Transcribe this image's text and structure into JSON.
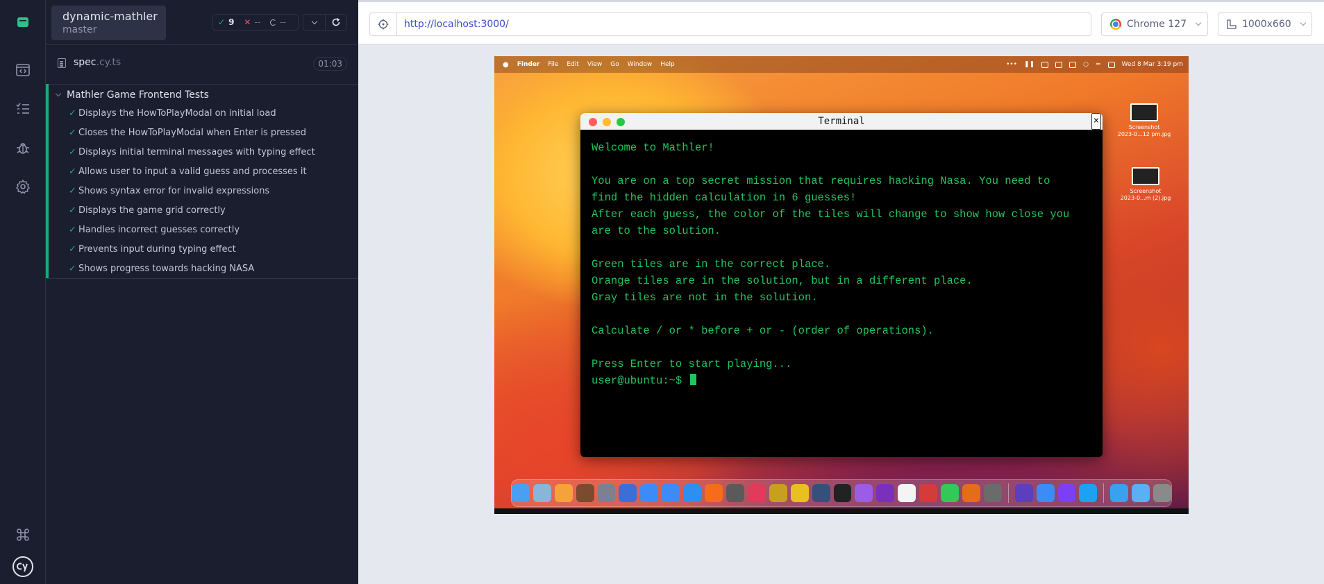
{
  "project": {
    "name": "dynamic-mathler",
    "branch": "master"
  },
  "stats": {
    "passed": "9",
    "failed": "--",
    "pending": "--"
  },
  "spec": {
    "name": "spec",
    "ext": ".cy.ts",
    "duration": "01:03"
  },
  "suite": {
    "title": "Mathler Game Frontend Tests",
    "tests": [
      "Displays the HowToPlayModal on initial load",
      "Closes the HowToPlayModal when Enter is pressed",
      "Displays initial terminal messages with typing effect",
      "Allows user to input a valid guess and processes it",
      "Shows syntax error for invalid expressions",
      "Displays the game grid correctly",
      "Handles incorrect guesses correctly",
      "Prevents input during typing effect",
      "Shows progress towards hacking NASA"
    ]
  },
  "browser": {
    "url": "http://localhost:3000/",
    "name": "Chrome 127",
    "viewport": "1000x660"
  },
  "mac": {
    "menu": [
      "Finder",
      "File",
      "Edit",
      "View",
      "Go",
      "Window",
      "Help"
    ],
    "clock": "Wed 8 Mar  3:19 pm",
    "desktop_files": [
      {
        "line1": "Screenshot",
        "line2": "2023-0...12 pm.jpg"
      },
      {
        "line1": "Screenshot",
        "line2": "2023-0...m (2).jpg"
      }
    ]
  },
  "terminal": {
    "title": "Terminal",
    "close": "×",
    "lines": [
      "Welcome to Mathler!",
      "",
      "You are on a top secret mission that requires hacking Nasa. You need to",
      "find the hidden calculation in 6 guesses!",
      "After each guess, the color of the tiles will change to show how close you",
      "are to the solution.",
      "",
      "Green tiles are in the correct place.",
      "Orange tiles are in the solution, but in a different place.",
      "Gray tiles are not in the solution.",
      "",
      "Calculate / or * before + or - (order of operations).",
      "",
      "Press Enter to start playing..."
    ],
    "prompt": "user@ubuntu:~$ "
  },
  "colors": {
    "pass": "#1fa971",
    "fail": "#e45770",
    "terminal_text": "#22c55e",
    "url": "#3a48c4"
  }
}
